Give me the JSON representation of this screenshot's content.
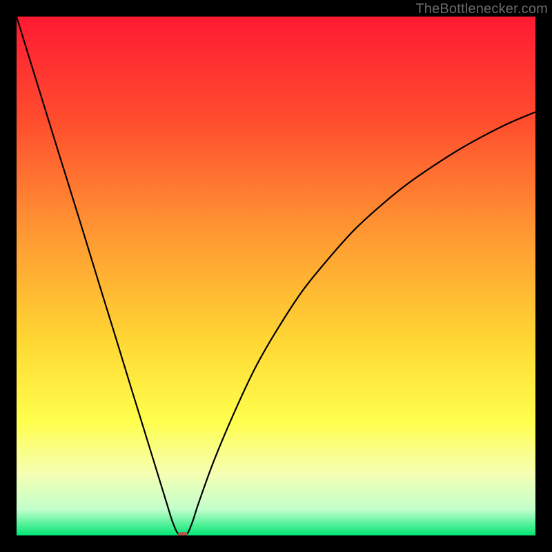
{
  "watermark": "TheBottlenecker.com",
  "chart_data": {
    "type": "line",
    "title": "",
    "xlabel": "",
    "ylabel": "",
    "xlim": [
      0,
      100
    ],
    "ylim": [
      0,
      100
    ],
    "gradient_stops": [
      {
        "pct": 0,
        "color": "#ff1a33"
      },
      {
        "pct": 20,
        "color": "#ff4d2e"
      },
      {
        "pct": 42,
        "color": "#ff9933"
      },
      {
        "pct": 62,
        "color": "#ffd633"
      },
      {
        "pct": 78,
        "color": "#ffff4d"
      },
      {
        "pct": 88,
        "color": "#f6ffb3"
      },
      {
        "pct": 95,
        "color": "#c2ffcc"
      },
      {
        "pct": 100,
        "color": "#00e673"
      }
    ],
    "series": [
      {
        "name": "bottleneck-curve",
        "x": [
          0,
          2,
          5,
          8,
          10,
          13,
          16,
          19,
          22,
          25,
          27,
          29,
          30,
          31,
          32,
          33,
          34,
          35,
          38,
          42,
          46,
          50,
          55,
          60,
          65,
          70,
          75,
          80,
          85,
          90,
          95,
          100
        ],
        "y": [
          100,
          93.5,
          83.8,
          74.1,
          67.7,
          58.0,
          48.2,
          38.5,
          28.7,
          19.0,
          12.5,
          6.0,
          2.8,
          0.5,
          0.0,
          0.5,
          2.9,
          6.0,
          14.3,
          23.8,
          32.3,
          39.3,
          47.0,
          53.2,
          58.8,
          63.4,
          67.5,
          71.0,
          74.2,
          77.0,
          79.5,
          81.6
        ]
      }
    ],
    "marker": {
      "x": 32,
      "y": 0,
      "name": "optimal-point"
    }
  }
}
